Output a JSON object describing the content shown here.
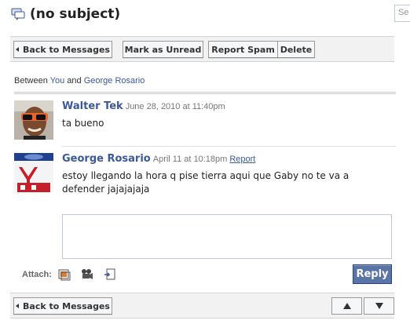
{
  "header": {
    "title": "(no subject)",
    "search_placeholder": "Se"
  },
  "toolbar": {
    "back_label": "Back to Messages",
    "mark_unread_label": "Mark as Unread",
    "report_spam_label": "Report Spam",
    "delete_label": "Delete"
  },
  "between": {
    "prefix": "Between",
    "you": "You",
    "and": "and",
    "other": "George Rosario"
  },
  "messages": [
    {
      "author": "Walter Tek",
      "time": "June 28, 2010 at 11:40pm",
      "body": "ta bueno",
      "report": ""
    },
    {
      "author": "George Rosario",
      "time": "April 11 at 10:18pm",
      "body": "estoy llegando la hora q pise tierra aqui que Gaby no te va a defender jajajajaja",
      "report": "Report"
    }
  ],
  "reply": {
    "textarea_value": "",
    "attach_label": "Attach:",
    "button_label": "Reply"
  },
  "bottom": {
    "back_label": "Back to Messages"
  },
  "colors": {
    "link": "#3b5998",
    "reply_button": "#5b74a8",
    "toolbar_bg": "#f2f2f2"
  },
  "icons": [
    "message-icon",
    "photo-attach-icon",
    "video-attach-icon",
    "share-link-icon",
    "up-arrow-icon",
    "down-arrow-icon"
  ]
}
